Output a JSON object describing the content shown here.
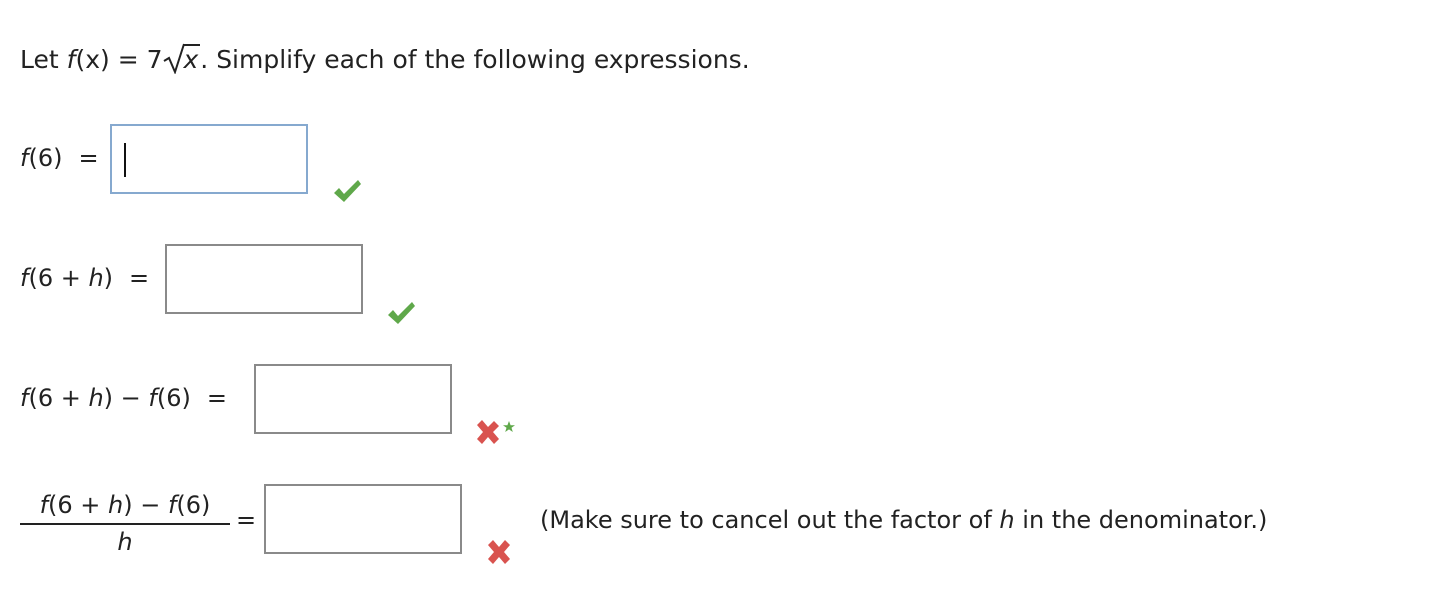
{
  "prompt": {
    "prefix": "Let ",
    "func": "f",
    "arg": "(x)",
    "equals": " = 7",
    "radicand": "x",
    "suffix": ". Simplify each of the following expressions."
  },
  "questions": [
    {
      "label_html_parts": [
        "f",
        "(6)"
      ],
      "equals": "=",
      "value": "",
      "status": "correct",
      "status_icon": "check-icon"
    },
    {
      "label_html_parts": [
        "f",
        "(6 + ",
        "h",
        ")"
      ],
      "equals": "=",
      "value": "",
      "status": "correct",
      "status_icon": "check-icon"
    },
    {
      "label_html_parts": [
        "f",
        "(6 + ",
        "h",
        ") − ",
        "f",
        "(6)"
      ],
      "equals": "=",
      "value": "",
      "status": "incorrect-partial",
      "status_icon": "cross-star-icon"
    },
    {
      "numerator_parts": [
        "f",
        "(6 + ",
        "h",
        ") − ",
        "f",
        "(6)"
      ],
      "denominator": "h",
      "equals": "=",
      "value": "",
      "status": "incorrect",
      "status_icon": "cross-icon"
    }
  ],
  "note": {
    "prefix": "(Make sure to cancel out the factor of ",
    "var": "h",
    "suffix": " in the denominator.)"
  },
  "colors": {
    "correct": "#5fa84a",
    "incorrect": "#d9534f",
    "focus_border": "#86a9cf",
    "box_border": "#8a8a8a"
  }
}
